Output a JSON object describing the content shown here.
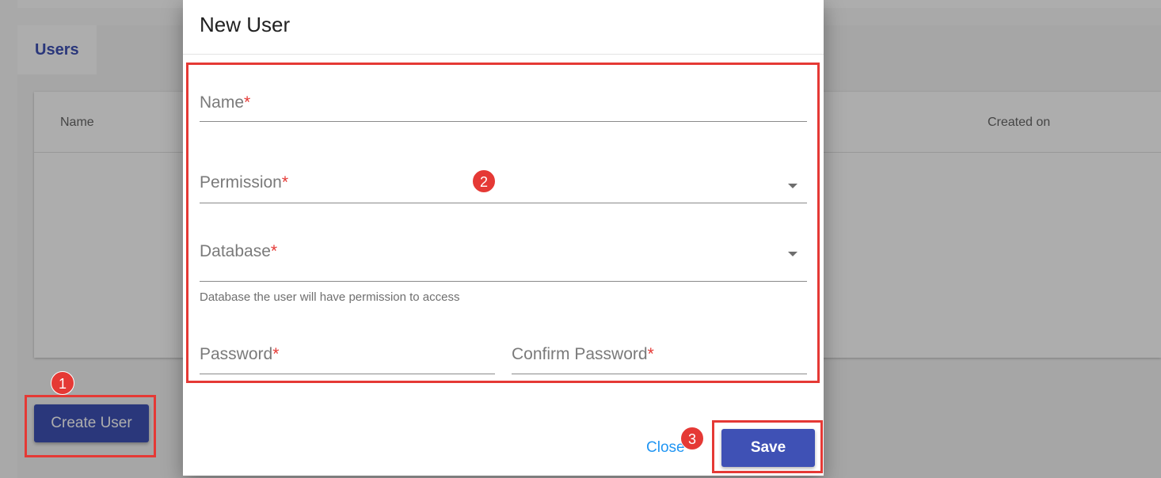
{
  "background": {
    "tab_label": "Users",
    "columns": [
      "Name",
      "Created on"
    ],
    "create_button_label": "Create User"
  },
  "dialog": {
    "title": "New User",
    "fields": {
      "name": {
        "label": "Name",
        "required_mark": "*",
        "value": ""
      },
      "permission": {
        "label": "Permission",
        "required_mark": "*",
        "value": ""
      },
      "database": {
        "label": "Database",
        "required_mark": "*",
        "value": "",
        "hint": "Database the user will have permission to access"
      },
      "password": {
        "label": "Password",
        "required_mark": "*",
        "value": ""
      },
      "confirm_password": {
        "label": "Confirm Password",
        "required_mark": "*",
        "value": ""
      }
    },
    "close_label": "Close",
    "save_label": "Save"
  },
  "annotations": {
    "badge_1": "1",
    "badge_2": "2",
    "badge_3": "3",
    "color": "#e53935"
  },
  "colors": {
    "primary": "#3f51b5",
    "link": "#2196f3",
    "required": "#e53935"
  }
}
